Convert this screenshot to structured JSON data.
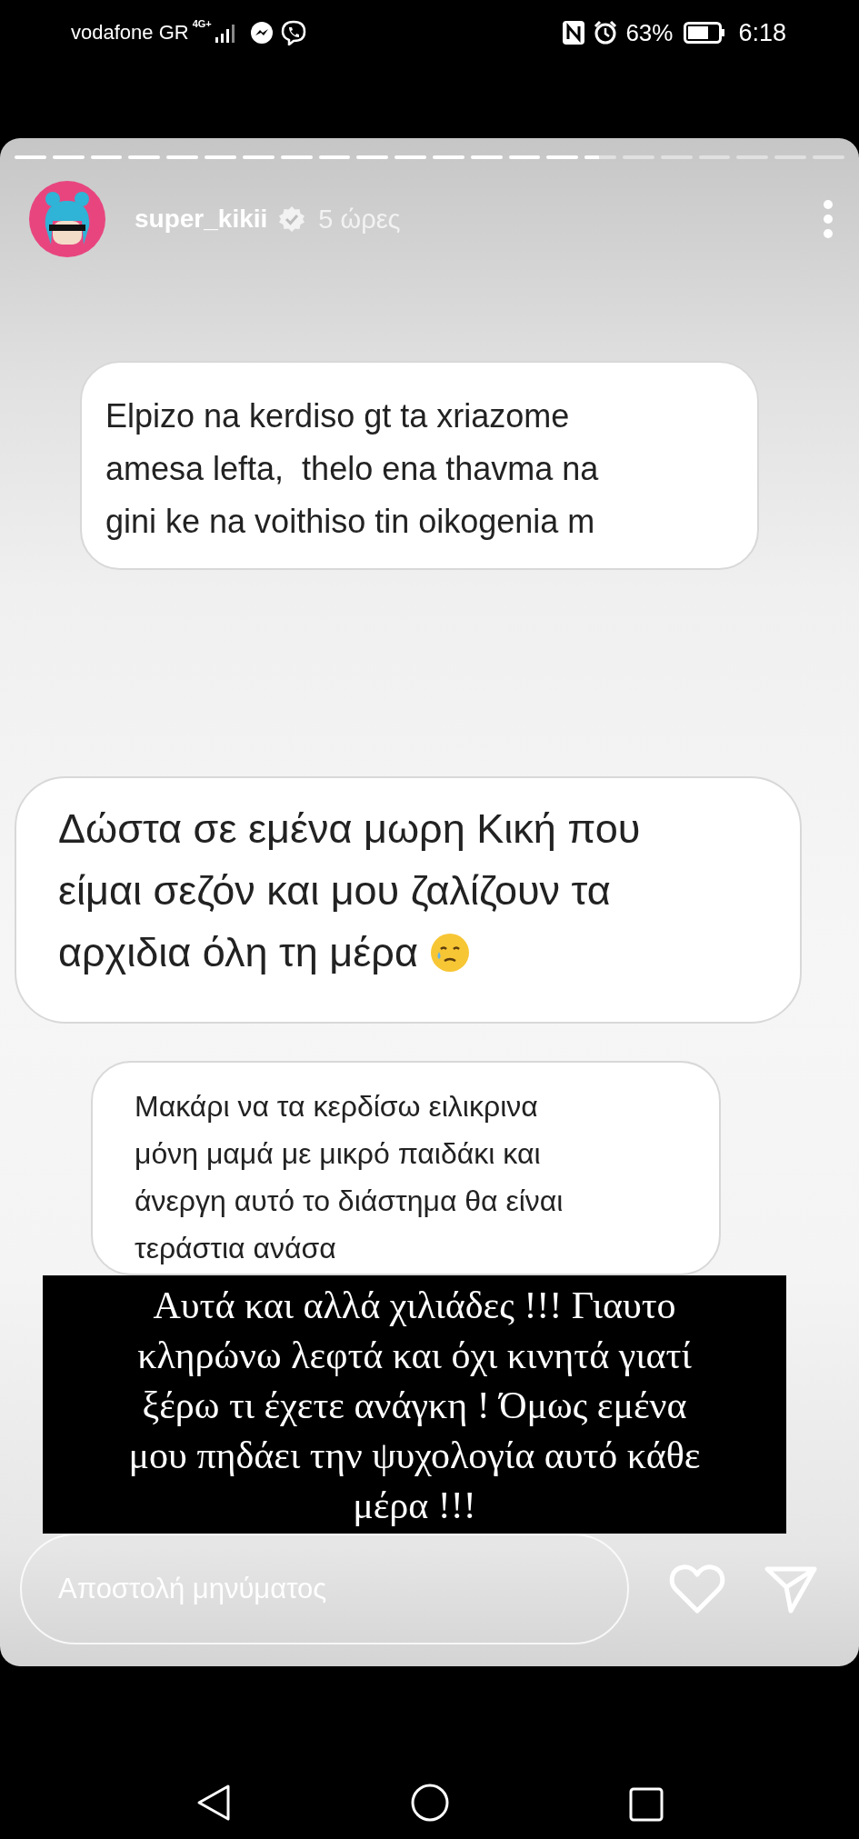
{
  "status_bar": {
    "carrier": "vodafone GR",
    "network": "4G+",
    "battery": "63%",
    "time": "6:18"
  },
  "story": {
    "segments": [
      {
        "level": 1
      },
      {
        "level": 1
      },
      {
        "level": 1
      },
      {
        "level": 1
      },
      {
        "level": 1
      },
      {
        "level": 1
      },
      {
        "level": 1
      },
      {
        "level": 1
      },
      {
        "level": 1
      },
      {
        "level": 1
      },
      {
        "level": 1
      },
      {
        "level": 1
      },
      {
        "level": 1
      },
      {
        "level": 1
      },
      {
        "level": 1
      },
      {
        "level": 0.45
      },
      {
        "level": 0
      },
      {
        "level": 0
      },
      {
        "level": 0
      },
      {
        "level": 0
      },
      {
        "level": 0
      },
      {
        "level": 0
      }
    ],
    "user": {
      "name": "super_kikii",
      "verified": true,
      "age": "5 ώρες"
    }
  },
  "messages": [
    {
      "kind": "medium",
      "text": "Elpizo na kerdiso gt ta xriazome\namesa lefta,  thelo ena thavma na\ngini ke na voithiso tin oikogenia m",
      "emoji": false
    },
    {
      "kind": "large",
      "text": "Δώστα σε εμένα μωρη Κική που\nείμαι σεζόν και μου ζαλίζουν τα\nαρχιδια όλη τη μέρα",
      "emoji": true
    },
    {
      "kind": "small",
      "text": "Μακάρι να τα κερδίσω ειλικρινα\nμόνη μαμά με μικρό παιδάκι και\nάνεργη αυτό το διάστημα θα είναι\nτεράστια ανάσα",
      "emoji": false
    }
  ],
  "caption": "Αυτά και αλλά χιλιάδες !!! Γιαυτο\nκληρώνω λεφτά και όχι κινητά γιατί\nξέρω τι έχετε ανάγκη ! Όμως εμένα\nμου πηδάει την ψυχολογία αυτό κάθε\nμέρα !!!",
  "reply": {
    "placeholder": "Αποστολή μηνύματος"
  }
}
